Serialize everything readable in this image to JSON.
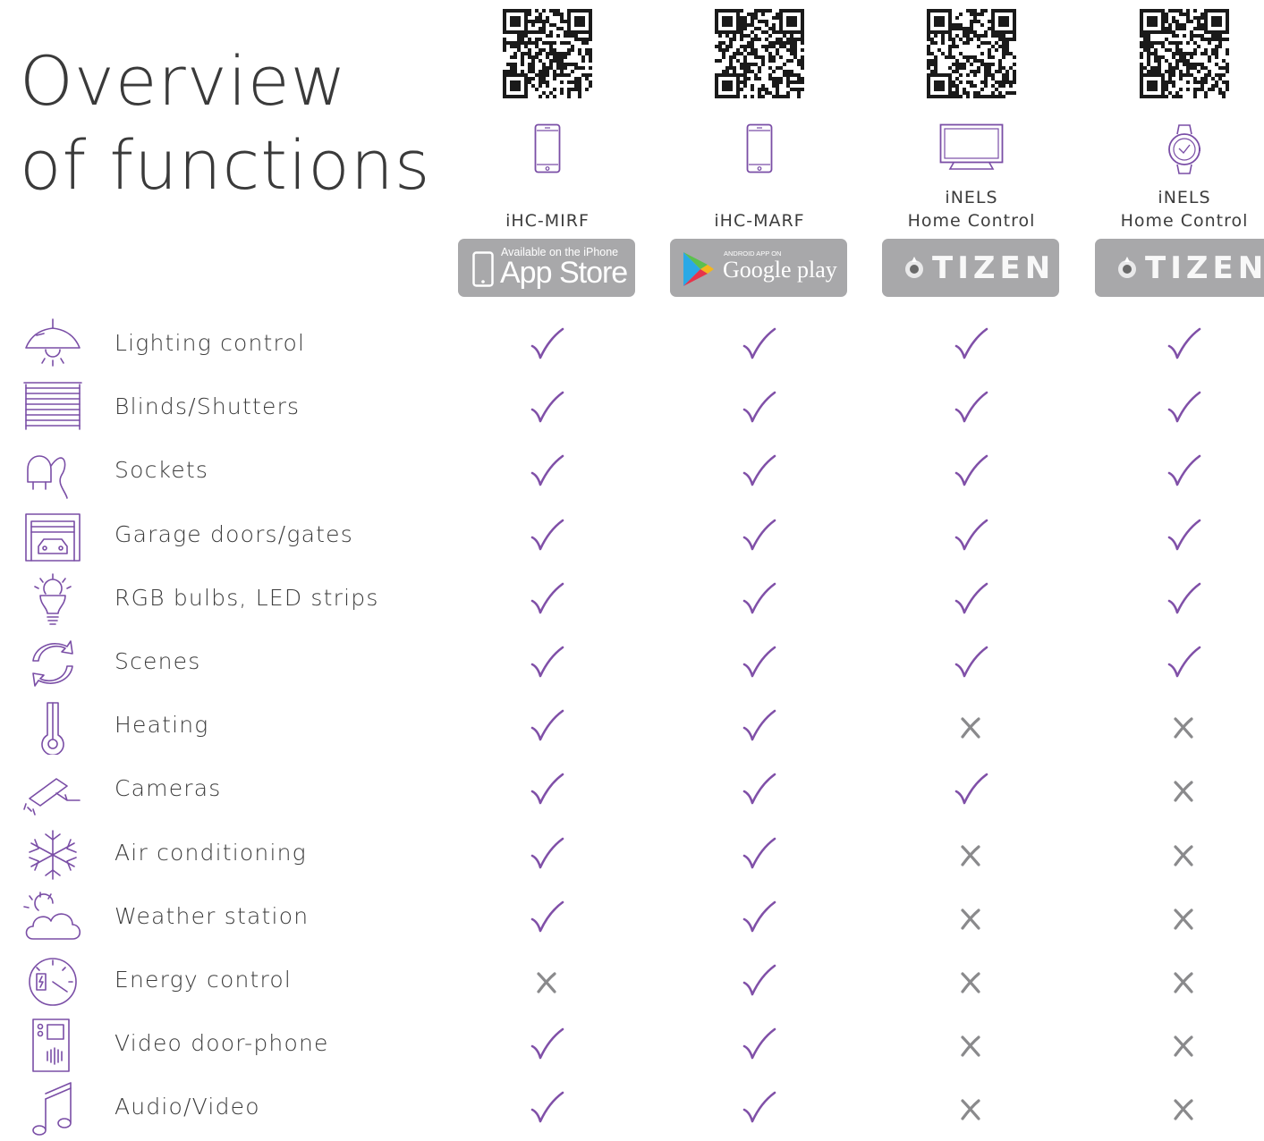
{
  "title": {
    "line1": "Overview",
    "line2": "of functions"
  },
  "colors": {
    "check": "#8050a8",
    "cross": "#8a8a8c",
    "line_icon": "#7a4ea6",
    "store_bg": "#a8a8aa"
  },
  "columns": [
    {
      "device_icon": "smartphone-icon",
      "name_line1": "",
      "name_line2": "iHC-MIRF",
      "store": {
        "type": "app-store-badge",
        "small": "Available on the iPhone",
        "big": "App Store"
      }
    },
    {
      "device_icon": "smartphone-icon",
      "name_line1": "",
      "name_line2": "iHC-MARF",
      "store": {
        "type": "google-play-badge",
        "small": "ANDROID APP ON",
        "big": "Google play"
      }
    },
    {
      "device_icon": "tv-icon",
      "name_line1": "iNELS",
      "name_line2": "Home Control",
      "store": {
        "type": "tizen-badge",
        "small": "",
        "big": "TIZEN"
      }
    },
    {
      "device_icon": "smartwatch-icon",
      "name_line1": "iNELS",
      "name_line2": "Home Control",
      "store": {
        "type": "tizen-badge",
        "small": "",
        "big": "TIZEN"
      }
    }
  ],
  "features": [
    {
      "label": "Lighting control",
      "icon": "ceiling-lamp-icon",
      "support": [
        true,
        true,
        true,
        true
      ]
    },
    {
      "label": "Blinds/Shutters",
      "icon": "blinds-icon",
      "support": [
        true,
        true,
        true,
        true
      ]
    },
    {
      "label": "Sockets",
      "icon": "plug-icon",
      "support": [
        true,
        true,
        true,
        true
      ]
    },
    {
      "label": "Garage doors/gates",
      "icon": "garage-icon",
      "support": [
        true,
        true,
        true,
        true
      ]
    },
    {
      "label": "RGB bulbs, LED strips",
      "icon": "bulb-icon",
      "support": [
        true,
        true,
        true,
        true
      ]
    },
    {
      "label": "Scenes",
      "icon": "refresh-arrows-icon",
      "support": [
        true,
        true,
        true,
        true
      ]
    },
    {
      "label": "Heating",
      "icon": "thermometer-icon",
      "support": [
        true,
        true,
        false,
        false
      ]
    },
    {
      "label": "Cameras",
      "icon": "security-camera-icon",
      "support": [
        true,
        true,
        true,
        false
      ]
    },
    {
      "label": "Air conditioning",
      "icon": "snowflake-icon",
      "support": [
        true,
        true,
        false,
        false
      ]
    },
    {
      "label": "Weather station",
      "icon": "sun-cloud-icon",
      "support": [
        true,
        true,
        false,
        false
      ]
    },
    {
      "label": "Energy control",
      "icon": "energy-meter-icon",
      "support": [
        false,
        true,
        false,
        false
      ]
    },
    {
      "label": "Video door-phone",
      "icon": "door-phone-icon",
      "support": [
        true,
        true,
        false,
        false
      ]
    },
    {
      "label": "Audio/Video",
      "icon": "music-note-icon",
      "support": [
        true,
        true,
        false,
        false
      ]
    }
  ]
}
